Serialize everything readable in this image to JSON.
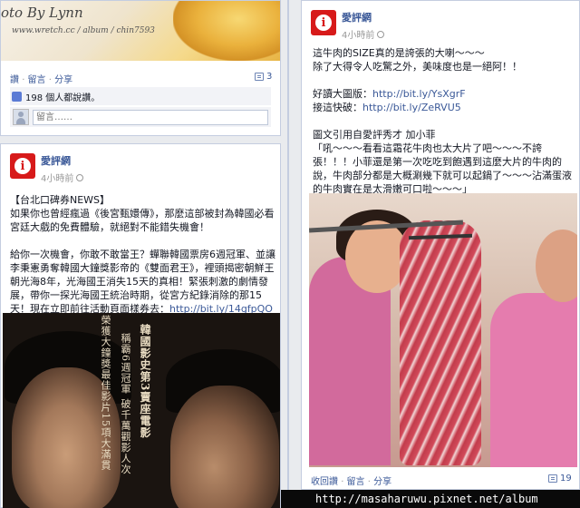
{
  "top_post": {
    "watermark_line1": "oto By Lynn",
    "watermark_line2": "www.wretch.cc / album / chin7593",
    "actions": {
      "like": "讚",
      "comment": "留言",
      "share": "分享"
    },
    "comment_count": "3",
    "likes_text": "198 個人都說讚。",
    "comment_placeholder": "留言……"
  },
  "left_post": {
    "page_name": "愛評網",
    "time": "4小時前",
    "text_before_link": "【台北口碑券NEWS】\n如果你也曾經瘋過《後宮甄嬛傳》，那麼這部被封為韓國必看宮廷大戲的免費體驗，就絕對不能錯失機會！\n\n給你一次機會，你敢不敢當王？蟬聯韓國票房6週冠軍、並讓李秉憲勇奪韓國大鐘獎影帝的《雙面君王》，裡頭揭密朝鮮王朝光海8年，光海國王消失15天的真相！緊張刺激的劇情發展，帶你一探光海國王統治時期，從宮方紀錄消除的那15天！現在立即前往活動頁面樣券去：",
    "link": "http://bit.ly/14gfpQO",
    "poster_text": {
      "col1": "韓國影史第3賣座電影",
      "col2": "稱霸6週冠軍 破千萬觀影人次",
      "col3": "榮獲大鐘獎最佳影片15項大滿貫"
    }
  },
  "right_post": {
    "page_name": "愛評網",
    "time": "4小時前",
    "para1": "這牛肉的SIZE真的是誇張的大喇～～～\n除了大得令人吃驚之外，美味度也是一絕阿！！",
    "good_store_label": "好讀大圖版：",
    "good_store_link": "http://bit.ly/YsXgrF",
    "fast_label": "接這快破：",
    "fast_link": "http://bit.ly/ZeRVU5",
    "para2": "圖文引用自愛評秀才 加小菲\n「吼～～～看看這霜花牛肉也太大片了吧～～～不誇張！！！小菲還是第一次吃吃到飽遇到這麼大片的牛肉的說，牛肉部分都是大概涮幾下就可以起鍋了～～～沾滿蛋液的牛肉實在是太滑嫩可口啦～～～」",
    "actions": {
      "like": "收回讚",
      "comment": "留言",
      "share": "分享"
    },
    "comment_count": "19"
  },
  "footer_url": "http://masaharuwu.pixnet.net/album",
  "colors": {
    "brand": "#3b5998",
    "logo_red": "#d71a1a",
    "background": "#e9ebee"
  }
}
